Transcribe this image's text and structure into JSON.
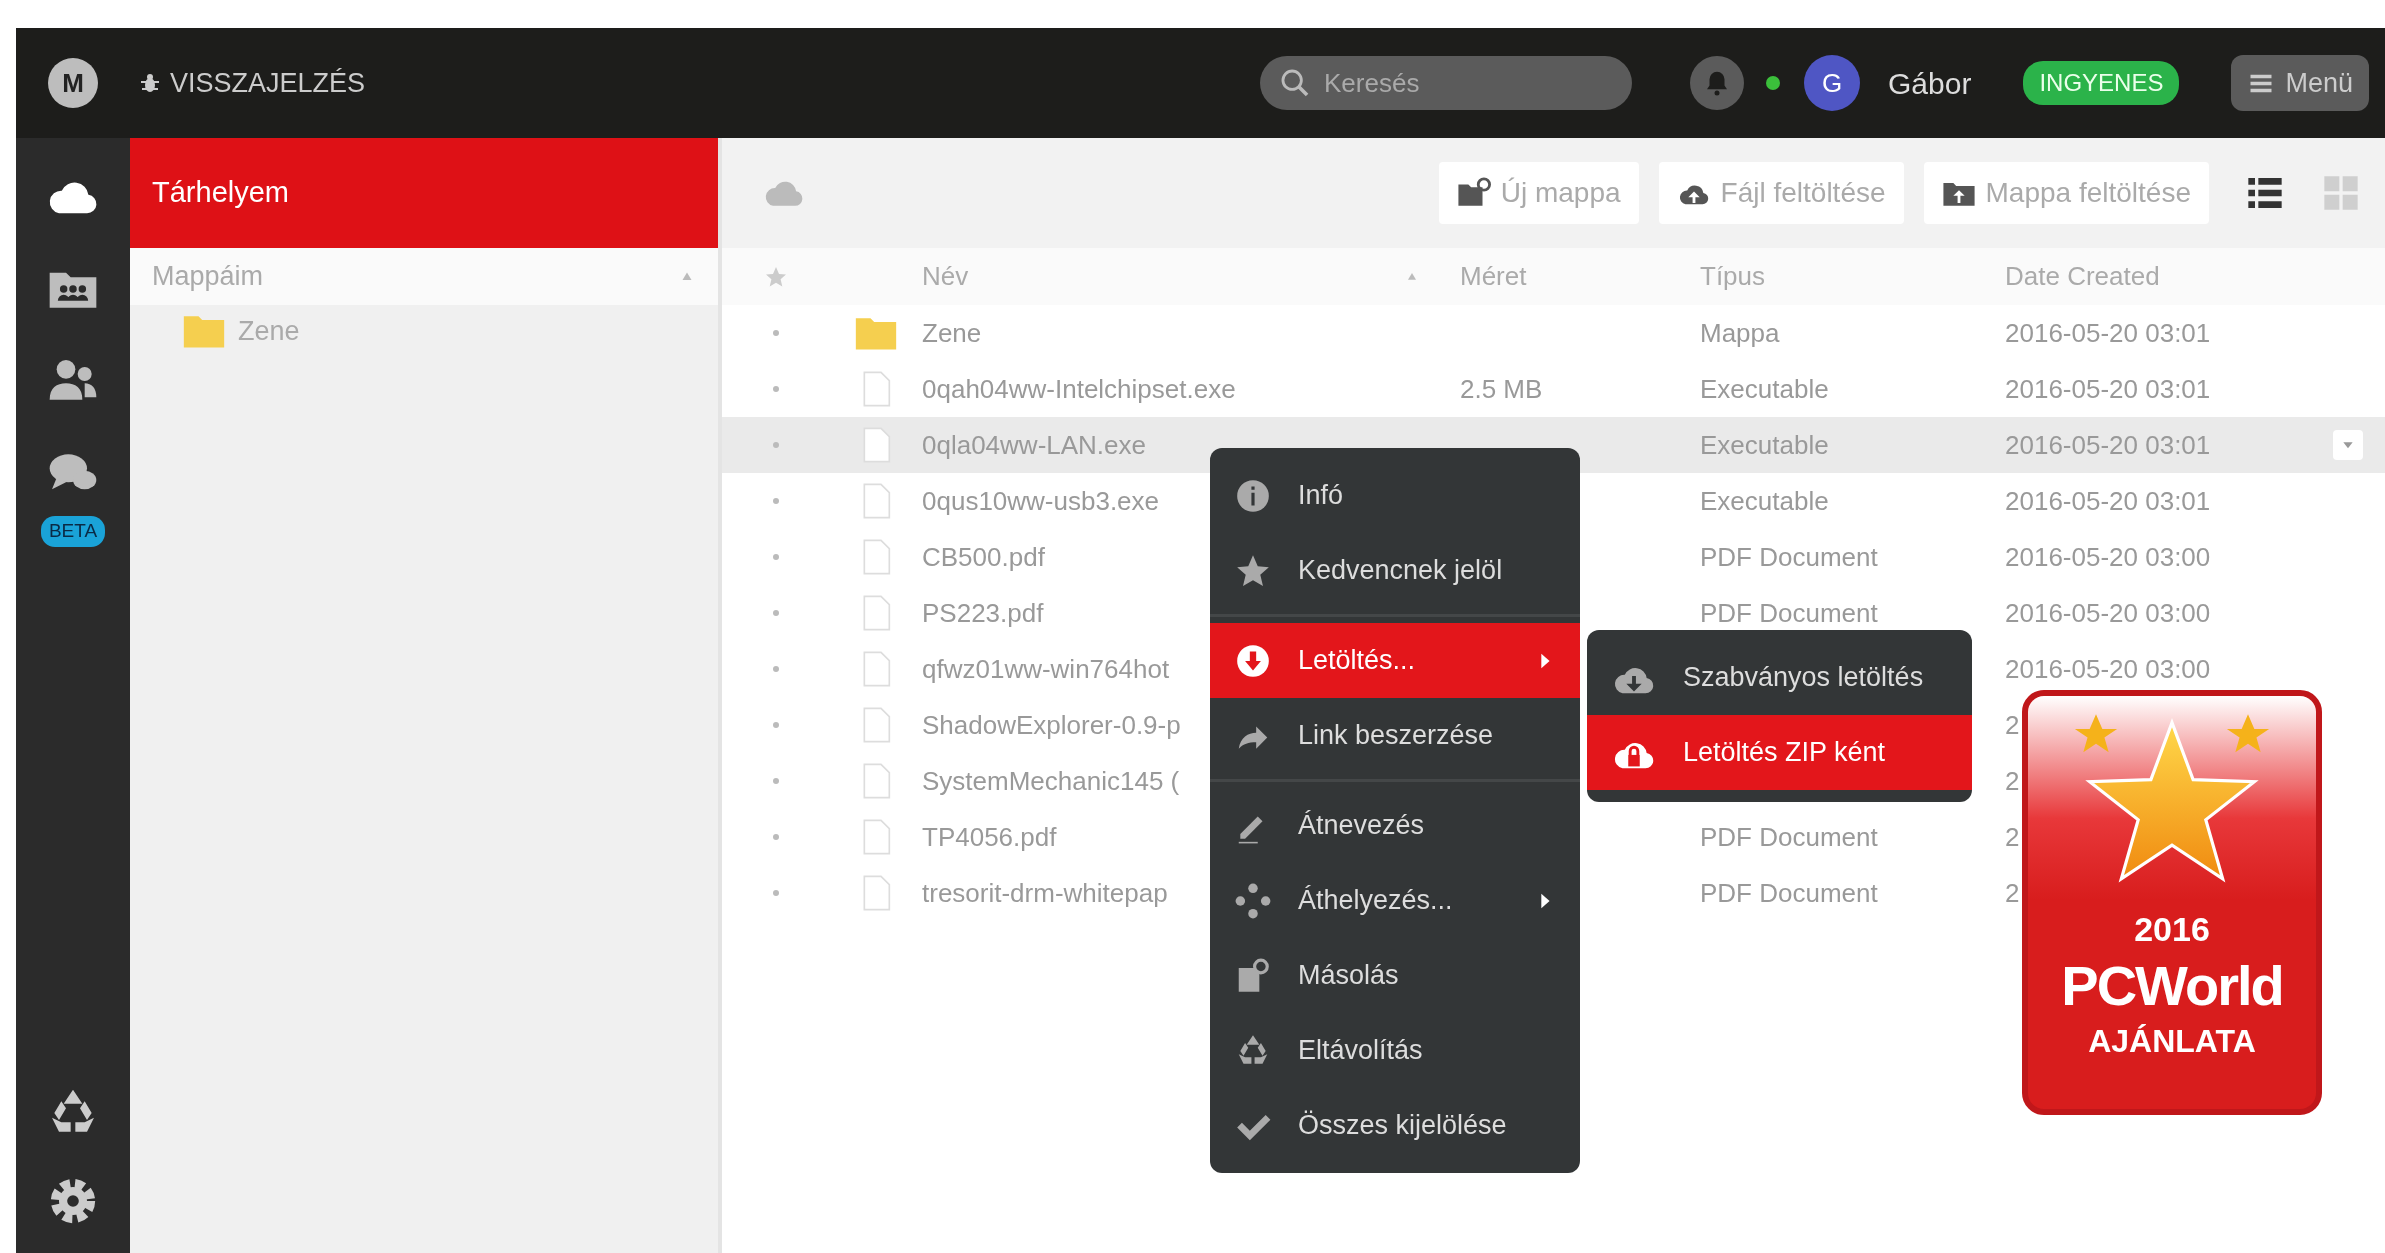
{
  "topbar": {
    "logo": "M",
    "feedback": "VISSZAJELZÉS",
    "search": {
      "placeholder": "Keresés"
    },
    "status_online": true,
    "avatar": "G",
    "user": "Gábor",
    "plan": "INGYENES",
    "menu": "Menü"
  },
  "rail": {
    "items": [
      {
        "kind": "cloud",
        "selected": true
      },
      {
        "kind": "shared",
        "selected": false
      },
      {
        "kind": "contacts",
        "selected": false
      },
      {
        "kind": "chat",
        "selected": false,
        "badge": "BETA"
      }
    ],
    "bottom": [
      {
        "kind": "rubbish"
      },
      {
        "kind": "settings"
      }
    ]
  },
  "tree": {
    "header": "Tárhelyem",
    "subheader": "Mappáim",
    "items": [
      {
        "label": "Zene"
      }
    ]
  },
  "toolbar": {
    "buttons": [
      {
        "kind": "new-folder",
        "label": "Új mappa"
      },
      {
        "kind": "upload-file",
        "label": "Fájl feltöltése"
      },
      {
        "kind": "upload-folder",
        "label": "Mappa feltöltése"
      }
    ],
    "views": [
      {
        "kind": "list",
        "selected": true
      },
      {
        "kind": "grid",
        "selected": false
      }
    ]
  },
  "table": {
    "columns": [
      "Név",
      "Méret",
      "Típus",
      "Date Created"
    ],
    "rows": [
      {
        "kind": "folder",
        "name": "Zene",
        "type": "Mappa",
        "date": "2016-05-20 03:01",
        "selected": false
      },
      {
        "kind": "file",
        "name": "0qah04ww-Intelchipset.exe",
        "size": "2.5 MB",
        "type": "Executable",
        "date": "2016-05-20 03:01",
        "selected": false
      },
      {
        "kind": "file",
        "name": "0qla04ww-LAN.exe",
        "type": "Executable",
        "date": "2016-05-20 03:01",
        "selected": true
      },
      {
        "kind": "file",
        "name": "0qus10ww-usb3.exe",
        "type": "Executable",
        "date": "2016-05-20 03:01",
        "selected": false
      },
      {
        "kind": "file",
        "name": "CB500.pdf",
        "type": "PDF Document",
        "date": "2016-05-20 03:00",
        "selected": false
      },
      {
        "kind": "file",
        "name": "PS223.pdf",
        "type": "PDF Document",
        "date": "2016-05-20 03:00",
        "selected": false
      },
      {
        "kind": "file",
        "name": "qfwz01ww-win764hot",
        "date": "2016-05-20 03:00",
        "selected": false
      },
      {
        "kind": "file",
        "name": "ShadowExplorer-0.9-p",
        "date": "2",
        "selected": false
      },
      {
        "kind": "file",
        "name": "SystemMechanic145 (",
        "date": "2",
        "selected": false
      },
      {
        "kind": "file",
        "name": "TP4056.pdf",
        "type": "PDF Document",
        "date": "2",
        "selected": false
      },
      {
        "kind": "file",
        "name": "tresorit-drm-whitepap",
        "type": "PDF Document",
        "date": "2",
        "selected": false
      }
    ]
  },
  "context_menu": {
    "groups": [
      {
        "items": [
          {
            "kind": "info",
            "label": "Infó",
            "submenu": false,
            "selected": false
          },
          {
            "kind": "star",
            "label": "Kedvencnek jelöl",
            "submenu": false,
            "selected": false
          }
        ]
      },
      {
        "items": [
          {
            "kind": "download",
            "label": "Letöltés...",
            "submenu": true,
            "selected": true
          },
          {
            "kind": "link",
            "label": "Link beszerzése",
            "submenu": false,
            "selected": false
          }
        ]
      },
      {
        "items": [
          {
            "kind": "rename",
            "label": "Átnevezés",
            "submenu": false,
            "selected": false
          },
          {
            "kind": "move",
            "label": "Áthelyezés...",
            "submenu": true,
            "selected": false
          },
          {
            "kind": "copy",
            "label": "Másolás",
            "submenu": false,
            "selected": false
          },
          {
            "kind": "remove",
            "label": "Eltávolítás",
            "submenu": false,
            "selected": false
          },
          {
            "kind": "check",
            "label": "Összes kijelölése",
            "submenu": false,
            "selected": false
          }
        ]
      }
    ]
  },
  "submenu": {
    "items": [
      {
        "kind": "cloud-download",
        "label": "Szabványos letöltés",
        "selected": false
      },
      {
        "kind": "cloud-zip",
        "label": "Letöltés ZIP ként",
        "selected": true
      }
    ]
  },
  "award_badge": {
    "year": "2016",
    "brand": "PCWorld",
    "caption": "AJÁNLATA"
  }
}
